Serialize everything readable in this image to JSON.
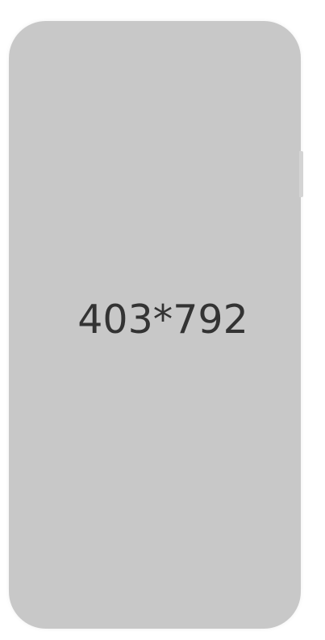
{
  "placeholder": {
    "dimensions_label": "403*792",
    "background_color": "#c8c8c8",
    "text_color": "#333333"
  }
}
